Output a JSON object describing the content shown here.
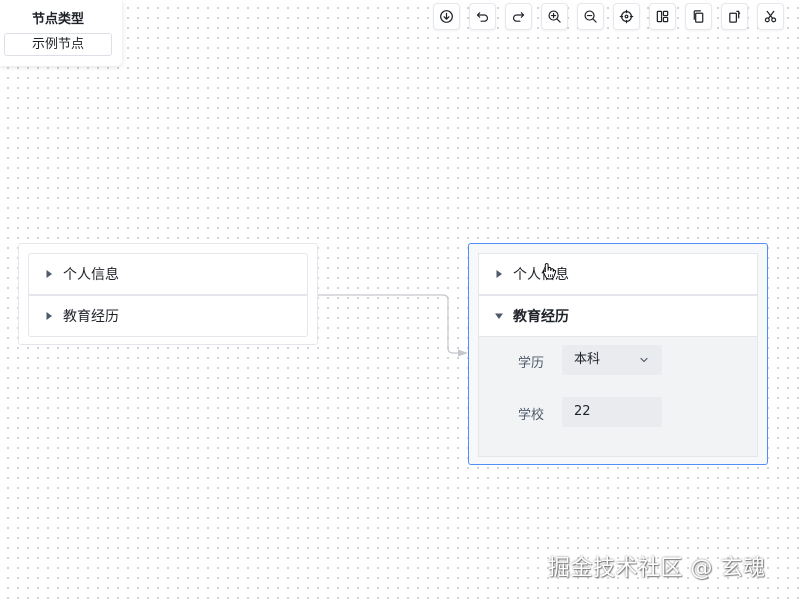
{
  "palette": {
    "title": "节点类型",
    "items": [
      {
        "label": "示例节点"
      }
    ]
  },
  "toolbar": {
    "buttons": [
      {
        "icon": "download-icon"
      },
      {
        "icon": "undo-icon"
      },
      {
        "icon": "redo-icon"
      },
      {
        "icon": "zoom-in-icon"
      },
      {
        "icon": "zoom-out-icon"
      },
      {
        "icon": "fit-view-icon"
      },
      {
        "icon": "layout-icon"
      },
      {
        "icon": "copy-icon"
      },
      {
        "icon": "paste-icon"
      },
      {
        "icon": "cut-icon"
      }
    ]
  },
  "nodes": {
    "left": {
      "sections": [
        {
          "label": "个人信息",
          "expanded": false
        },
        {
          "label": "教育经历",
          "expanded": false
        }
      ]
    },
    "right": {
      "selected": true,
      "sections": [
        {
          "label": "个人信息",
          "expanded": false
        },
        {
          "label": "教育经历",
          "expanded": true
        }
      ],
      "fields": {
        "education": {
          "label": "学历",
          "value": "本科"
        },
        "school": {
          "label": "学校",
          "value": "22"
        }
      }
    }
  },
  "colors": {
    "selected_border": "#4f8ff7",
    "edge": "#c3c6cc",
    "canvas_dot": "#c9cdd4"
  },
  "watermark": "掘金技术社区 @ 玄魂"
}
